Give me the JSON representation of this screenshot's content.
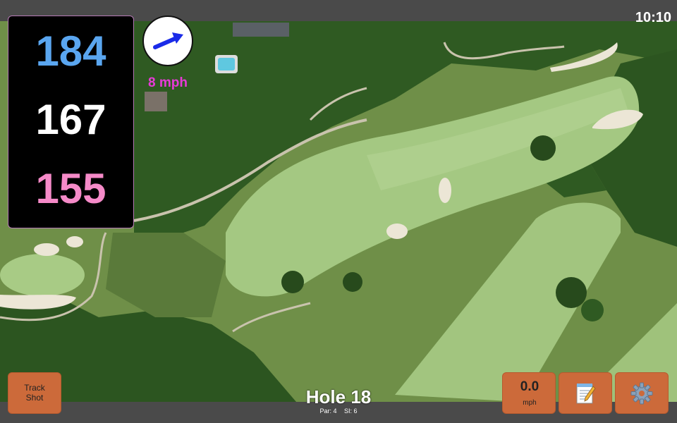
{
  "status": {
    "clock": "10:10"
  },
  "distances": {
    "back": "184",
    "middle": "167",
    "front": "155"
  },
  "wind_indicator": {
    "speed_label": "8 mph",
    "arrow_icon": "wind-direction-arrow-icon",
    "arrow_color": "#1a2be8"
  },
  "hole": {
    "title": "Hole 18",
    "par_label": "Par: 4",
    "si_label": "SI: 6"
  },
  "buttons": {
    "track_shot_line1": "Track",
    "track_shot_line2": "Shot",
    "wind_value": "0.0",
    "wind_unit": "mph",
    "notes_icon": "notepad-icon",
    "settings_icon": "gear-icon"
  },
  "colors": {
    "back_distance": "#5aa6f0",
    "middle_distance": "#ffffff",
    "front_distance": "#f58ac8",
    "wind_speed_text": "#e83ad8",
    "button_bg": "#cc6a3a"
  }
}
